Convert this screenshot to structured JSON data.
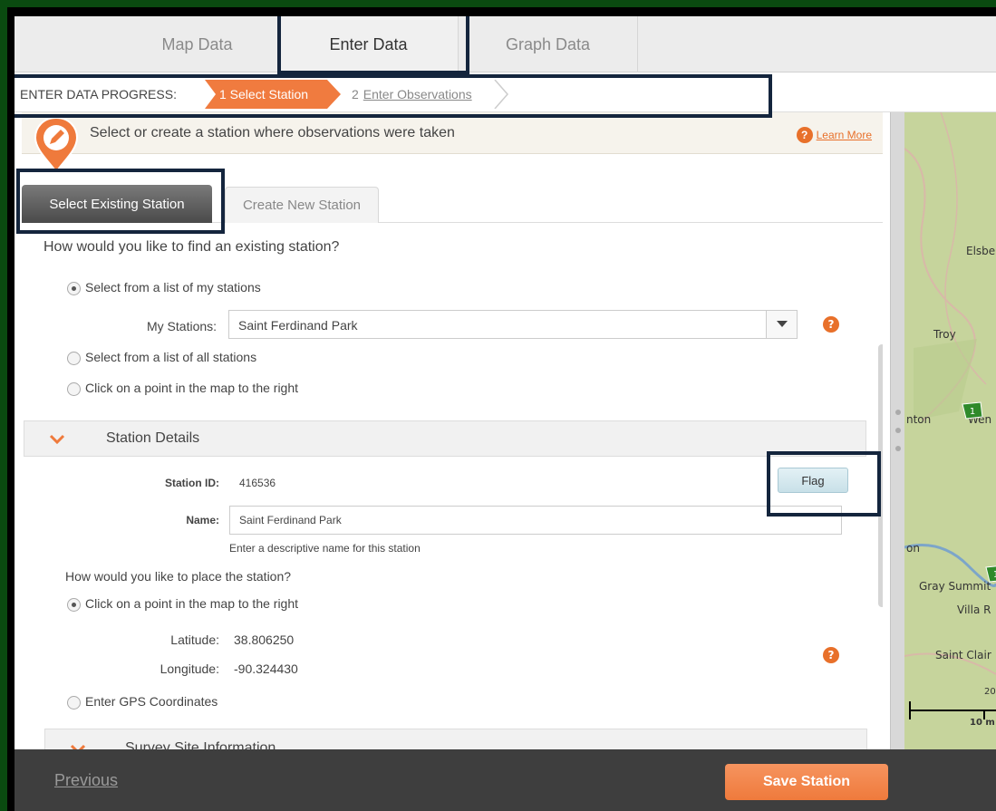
{
  "top_tabs": [
    {
      "label": "Map Data",
      "active": false
    },
    {
      "label": "Enter Data",
      "active": true
    },
    {
      "label": "Graph Data",
      "active": false
    }
  ],
  "progress": {
    "label": "ENTER DATA PROGRESS:",
    "step1": "1 Select Station",
    "step2_num": "2",
    "step2_link": "Enter Observations"
  },
  "info": {
    "text": "Select or create a station where observations were taken",
    "learn_more": "Learn More",
    "help_glyph": "?"
  },
  "station_tabs": {
    "existing": "Select Existing Station",
    "create": "Create New Station"
  },
  "find": {
    "question": "How would you like to find an existing station?",
    "option_my": "Select from a list of my stations",
    "my_stations_label": "My Stations:",
    "my_stations_value": "Saint Ferdinand Park",
    "option_all": "Select from a list of all stations",
    "option_map": "Click on a point in the map to the right",
    "selected_option": "my"
  },
  "details": {
    "title": "Station Details",
    "station_id_label": "Station ID:",
    "station_id": "416536",
    "flag_label": "Flag",
    "name_label": "Name:",
    "name_value": "Saint Ferdinand Park",
    "name_hint": "Enter a descriptive name for this station",
    "place_question": "How would you like to place the station?",
    "place_option_map": "Click on a point in the map to the right",
    "latitude_label": "Latitude:",
    "latitude": "38.806250",
    "longitude_label": "Longitude:",
    "longitude": "-90.324430",
    "place_option_gps": "Enter GPS Coordinates"
  },
  "survey": {
    "title": "Survey Site Information"
  },
  "map": {
    "labels": [
      "Elsbe",
      "Troy",
      "nton",
      "Wen",
      "on",
      "Gray Summit",
      "Villa R",
      "Saint Clair",
      "20",
      "10 m"
    ],
    "marker_count": "1"
  },
  "footer": {
    "previous": "Previous",
    "save": "Save Station"
  },
  "colors": {
    "accent": "#f07b3f",
    "footer_bg": "#3e3e3e",
    "highlight": "#14253d",
    "outer_border": "#0a4a10"
  }
}
